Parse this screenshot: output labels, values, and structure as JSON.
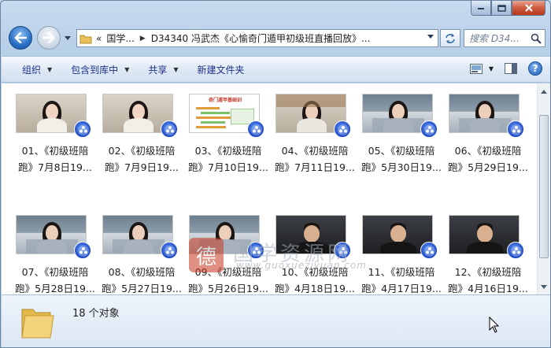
{
  "window": {
    "caption_buttons": [
      "minimize",
      "maximize",
      "close"
    ]
  },
  "address_bar": {
    "prefix": "«",
    "segments": [
      "国学...",
      "D34340 冯武杰《心愉奇门遁甲初级班直播回放》..."
    ]
  },
  "search": {
    "placeholder": "搜索 D34..."
  },
  "toolbar": {
    "organize": "组织",
    "include_in_library": "包含到库中",
    "share": "共享",
    "new_folder": "新建文件夹"
  },
  "files": [
    {
      "line1": "01、《初级班陪",
      "line2": "跑》7月8日19...",
      "scene": "room"
    },
    {
      "line1": "02、《初级班陪",
      "line2": "跑》7月9日19...",
      "scene": "room"
    },
    {
      "line1": "03、《初级班陪",
      "line2": "跑》7月10日19...",
      "scene": "doc"
    },
    {
      "line1": "04、《初级班陪",
      "line2": "跑》7月11日19...",
      "scene": "shelf-wood"
    },
    {
      "line1": "05、《初级班陪",
      "line2": "跑》5月30日19...",
      "scene": "shelf"
    },
    {
      "line1": "06、《初级班陪",
      "line2": "跑》5月29日19...",
      "scene": "shelf"
    },
    {
      "line1": "07、《初级班陪",
      "line2": "跑》5月28日19...",
      "scene": "shelf"
    },
    {
      "line1": "08、《初级班陪",
      "line2": "跑》5月27日19...",
      "scene": "shelf"
    },
    {
      "line1": "09、《初级班陪",
      "line2": "跑》5月26日19...",
      "scene": "shelf"
    },
    {
      "line1": "10、《初级班陪",
      "line2": "跑》4月18日19...",
      "scene": "dark"
    },
    {
      "line1": "11、《初级班陪",
      "line2": "跑》4月17日19...",
      "scene": "dark"
    },
    {
      "line1": "12、《初级班陪",
      "line2": "跑》4月16日19...",
      "scene": "dark"
    }
  ],
  "doc_thumb_title": "奇门遁甲基础训",
  "status": {
    "count": "18 个对象"
  },
  "watermark": {
    "seal": "德",
    "name": "国学资源网",
    "url": "www.guoxueziyuan.com"
  }
}
